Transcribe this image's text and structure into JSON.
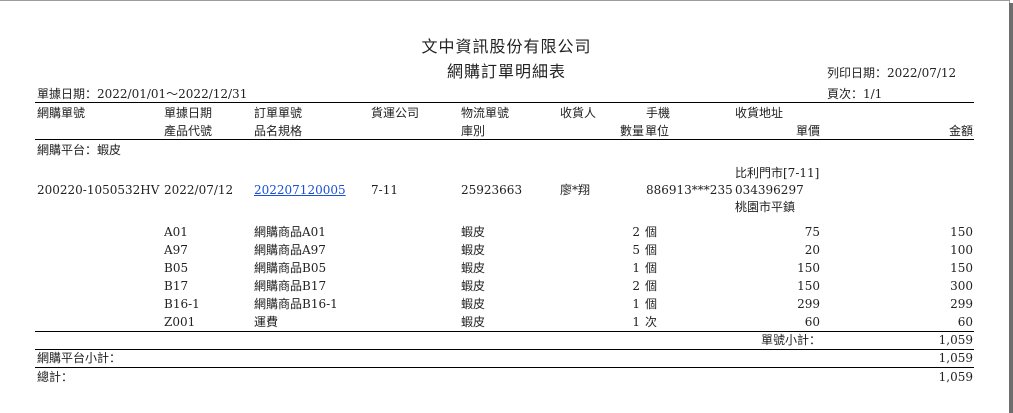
{
  "report": {
    "company": "文中資訊股份有限公司",
    "title": "網購訂單明細表",
    "date_range_label": "單據日期：2022/01/01～2022/12/31",
    "print_date_label": "列印日期：2022/07/12",
    "page_label": "頁次：1/1"
  },
  "headers": {
    "row1": {
      "order_no": "網購單號",
      "doc_date": "單據日期",
      "sales_no": "訂單單號",
      "carrier": "貨運公司",
      "logistics_no": "物流單號",
      "recipient": "收貨人",
      "phone": "手機",
      "address": "收貨地址"
    },
    "row2": {
      "product_code": "產品代號",
      "spec": "品名規格",
      "warehouse": "庫別",
      "qty": "數量",
      "unit": "單位",
      "price": "單價",
      "amount": "金額"
    }
  },
  "group": {
    "label": "網購平台：蝦皮",
    "order": {
      "order_no": "200220-1050532HV",
      "date": "2022/07/12",
      "sales_no": "202207120005",
      "carrier": "7-11",
      "logistics_no": "25923663",
      "recipient": "廖*翔",
      "phone": "886913***235",
      "address_lines": [
        "比利門市[7-11]",
        "034396297",
        "桃園市平鎮"
      ]
    },
    "items": [
      {
        "code": "A01",
        "name": "網購商品A01",
        "warehouse": "蝦皮",
        "qty": "2",
        "unit": "個",
        "price": "75",
        "amount": "150"
      },
      {
        "code": "A97",
        "name": "網購商品A97",
        "warehouse": "蝦皮",
        "qty": "5",
        "unit": "個",
        "price": "20",
        "amount": "100"
      },
      {
        "code": "B05",
        "name": "網購商品B05",
        "warehouse": "蝦皮",
        "qty": "1",
        "unit": "個",
        "price": "150",
        "amount": "150"
      },
      {
        "code": "B17",
        "name": "網購商品B17",
        "warehouse": "蝦皮",
        "qty": "2",
        "unit": "個",
        "price": "150",
        "amount": "300"
      },
      {
        "code": "B16-1",
        "name": "網購商品B16-1",
        "warehouse": "蝦皮",
        "qty": "1",
        "unit": "個",
        "price": "299",
        "amount": "299"
      },
      {
        "code": "Z001",
        "name": "運費",
        "warehouse": "蝦皮",
        "qty": "1",
        "unit": "次",
        "price": "60",
        "amount": "60"
      }
    ],
    "order_subtotal_label": "單號小計：",
    "order_subtotal": "1,059"
  },
  "platform_subtotal_label": "網購平台小計：",
  "platform_subtotal": "1,059",
  "grand_total_label": "總計：",
  "grand_total": "1,059"
}
